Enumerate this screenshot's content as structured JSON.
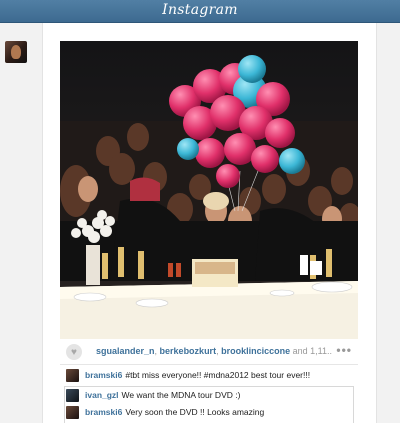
{
  "header": {
    "logo_text": "Instagram"
  },
  "post": {
    "owner_avatar_icon": "user-avatar-icon",
    "like_icon": "heart-icon",
    "likers": [
      "sgualander_n",
      "berkebozkurt",
      "brooklinciccone"
    ],
    "likers_more": "and 1,11...",
    "more_options_label": "•••"
  },
  "comments": [
    {
      "user": "bramski6",
      "text": "#tbt miss everyone!! #mdna2012 best tour ever!!!"
    },
    {
      "user": "ivan_gzl",
      "text": "We want the MDNA tour DVD :)"
    },
    {
      "user": "bramski6",
      "text": "Very soon the DVD !! Looks amazing"
    }
  ],
  "colors": {
    "header_blue": "#3d6a90",
    "link_blue": "#3f729b",
    "balloon_pink": "#e0306a",
    "balloon_cyan": "#3cb7d6"
  }
}
